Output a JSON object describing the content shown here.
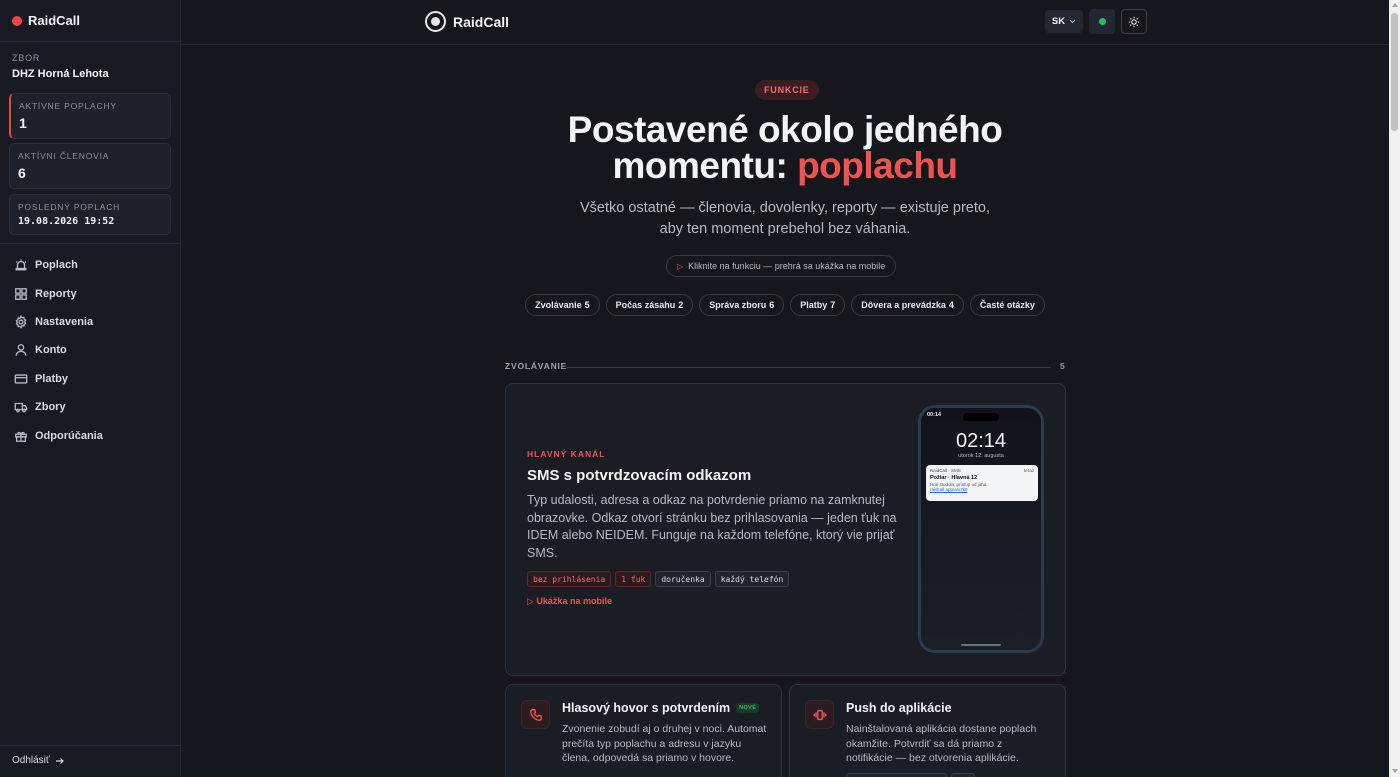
{
  "app": {
    "name": "RaidCall"
  },
  "sidebar": {
    "zbor_label": "ZBOR",
    "zbor_name": "DHZ Horná Lehota",
    "stats": [
      {
        "label": "AKTÍVNE POPLACHY",
        "value": "1"
      },
      {
        "label": "AKTÍVNI ČLENOVIA",
        "value": "6"
      },
      {
        "label": "POSLEDNÝ POPLACH",
        "value": "19.08.2026 19:52"
      }
    ],
    "nav": [
      {
        "label": "Poplach",
        "icon": "siren-icon"
      },
      {
        "label": "Reporty",
        "icon": "grid-icon"
      },
      {
        "label": "Nastavenia",
        "icon": "gear-icon"
      },
      {
        "label": "Konto",
        "icon": "user-icon"
      },
      {
        "label": "Platby",
        "icon": "card-icon"
      },
      {
        "label": "Zbory",
        "icon": "truck-icon"
      },
      {
        "label": "Odporúčania",
        "icon": "gift-icon"
      }
    ],
    "logout": "Odhlásiť"
  },
  "topbar": {
    "logo": "RaidCall",
    "language": "SK"
  },
  "main": {
    "tag": "FUNKCIE",
    "hero_line1": "Postavené okolo jedného",
    "hero_line2_prefix": "momentu: ",
    "hero_line2_accent": "poplachu",
    "sub_line1": "Všetko ostatné — členovia, dovolenky, reporty — existuje preto,",
    "sub_line2": "aby ten moment prebehol bez váhania.",
    "hint": "Kliknite na funkciu — prehrá sa ukážka na mobile",
    "chips": [
      {
        "label": "Zvolávanie",
        "count": "5"
      },
      {
        "label": "Počas zásahu",
        "count": "2"
      },
      {
        "label": "Správa zboru",
        "count": "6"
      },
      {
        "label": "Platby",
        "count": "7"
      },
      {
        "label": "Dôvera a prevádzka",
        "count": "4"
      },
      {
        "label": "Časté otázky",
        "count": ""
      }
    ],
    "section": {
      "label": "ZVOLÁVANIE",
      "count": "5"
    },
    "feature": {
      "kicker": "HLAVNÝ KANÁL",
      "title": "SMS s potvrdzovacím odkazom",
      "description": "Typ udalosti, adresa a odkaz na potvrdenie priamo na zamknutej obrazovke. Odkaz otvorí stránku bez prihlasovania — jeden ťuk na IDEM alebo NEIDEM. Funguje na každom telefóne, ktorý vie prijať SMS.",
      "tags": [
        {
          "label": "bez prihlásenia",
          "accent": true
        },
        {
          "label": "1 ťuk",
          "accent": true
        },
        {
          "label": "doručenka",
          "accent": false
        },
        {
          "label": "každý telefón",
          "accent": false
        }
      ],
      "link": "Ukážka na mobile",
      "phone": {
        "status_time": "00:14",
        "clock": "02:14",
        "date": "utorok 12. augusta",
        "notif_app": "RaidCall · SMS",
        "notif_time": "teraz",
        "notif_title": "Požiar · Hlavná 12",
        "notif_body": "Hori stodola, prístup od juhu.",
        "notif_link": "raidcall.app/a/x7k9"
      }
    },
    "cards": [
      {
        "title": "Hlasový hovor s potvrdením",
        "badge": "NOVÉ",
        "description": "Zvonenie zobudí aj o druhej v noci. Automat prečíta typ poplachu a adresu v jazyku člena, odpovedá sa priamo v hovore.",
        "icon": "phone-icon"
      },
      {
        "title": "Push do aplikácie",
        "badge": "",
        "description": "Nainštalovaná aplikácia dostane poplach okamžite. Potvrdiť sa dá priamo z notifikácie — bez otvorenia aplikácie.",
        "icon": "vibrate-icon"
      }
    ]
  },
  "colors": {
    "accent": "#ef5350",
    "background": "#15171c",
    "online": "#22c55e"
  }
}
